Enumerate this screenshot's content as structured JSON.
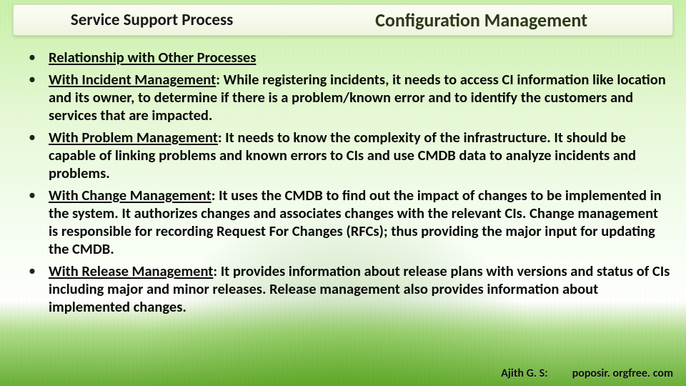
{
  "header": {
    "left": "Service Support Process",
    "right": "Configuration Management"
  },
  "bullets": [
    {
      "heading": "Relationship with Other Processes",
      "lead": "",
      "body": ""
    },
    {
      "heading": "",
      "lead": "With Incident Management",
      "body": ": While registering incidents, it needs to access CI information like location and its owner, to determine if there is a problem/known error and to identify the customers and services that are impacted."
    },
    {
      "heading": "",
      "lead": "With Problem Management",
      "body": ": It needs to know the complexity of the infrastructure. It should be capable of linking problems and known errors to CIs and use CMDB data to analyze incidents and problems."
    },
    {
      "heading": "",
      "lead": "With Change Management",
      "body": ": It uses the CMDB to find out the impact of changes to be implemented in the system. It authorizes changes and associates changes with the relevant CIs. Change management is responsible for recording Request For Changes (RFCs); thus providing the major input for updating the CMDB."
    },
    {
      "heading": "",
      "lead": "With Release Management",
      "body": ": It provides information about release plans with versions and status of CIs including major and minor releases. Release management also provides information about implemented changes."
    }
  ],
  "footer": {
    "author": "Ajith G. S:",
    "site": "poposir. orgfree. com"
  }
}
